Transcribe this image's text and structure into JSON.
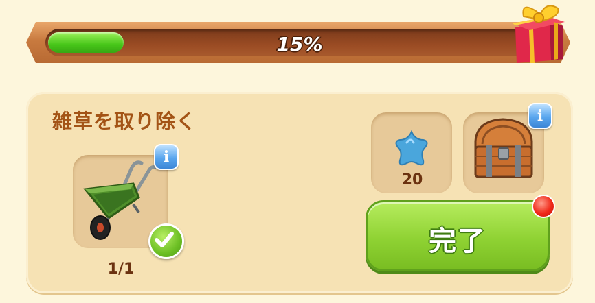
{
  "progress": {
    "percent_text": "15%",
    "value": 0.15
  },
  "gift": {
    "icon": "gift-box-icon"
  },
  "task": {
    "title": "雑草を取り除く",
    "tool": {
      "icon": "wheelbarrow-icon",
      "count_text": "1/1",
      "completed": true
    },
    "rewards": [
      {
        "icon": "blue-star-icon",
        "amount": "20"
      },
      {
        "icon": "treasure-chest-icon"
      }
    ],
    "info_label": "i",
    "done_button": {
      "label": "完了",
      "notification": true
    }
  },
  "colors": {
    "background": "#fdf6dc",
    "panel": "#f6e2b4",
    "title": "#a35416",
    "progress_fill": "#47c619",
    "button": "#8fd233",
    "notification": "#f02a1a",
    "info": "#5aa6ee"
  }
}
